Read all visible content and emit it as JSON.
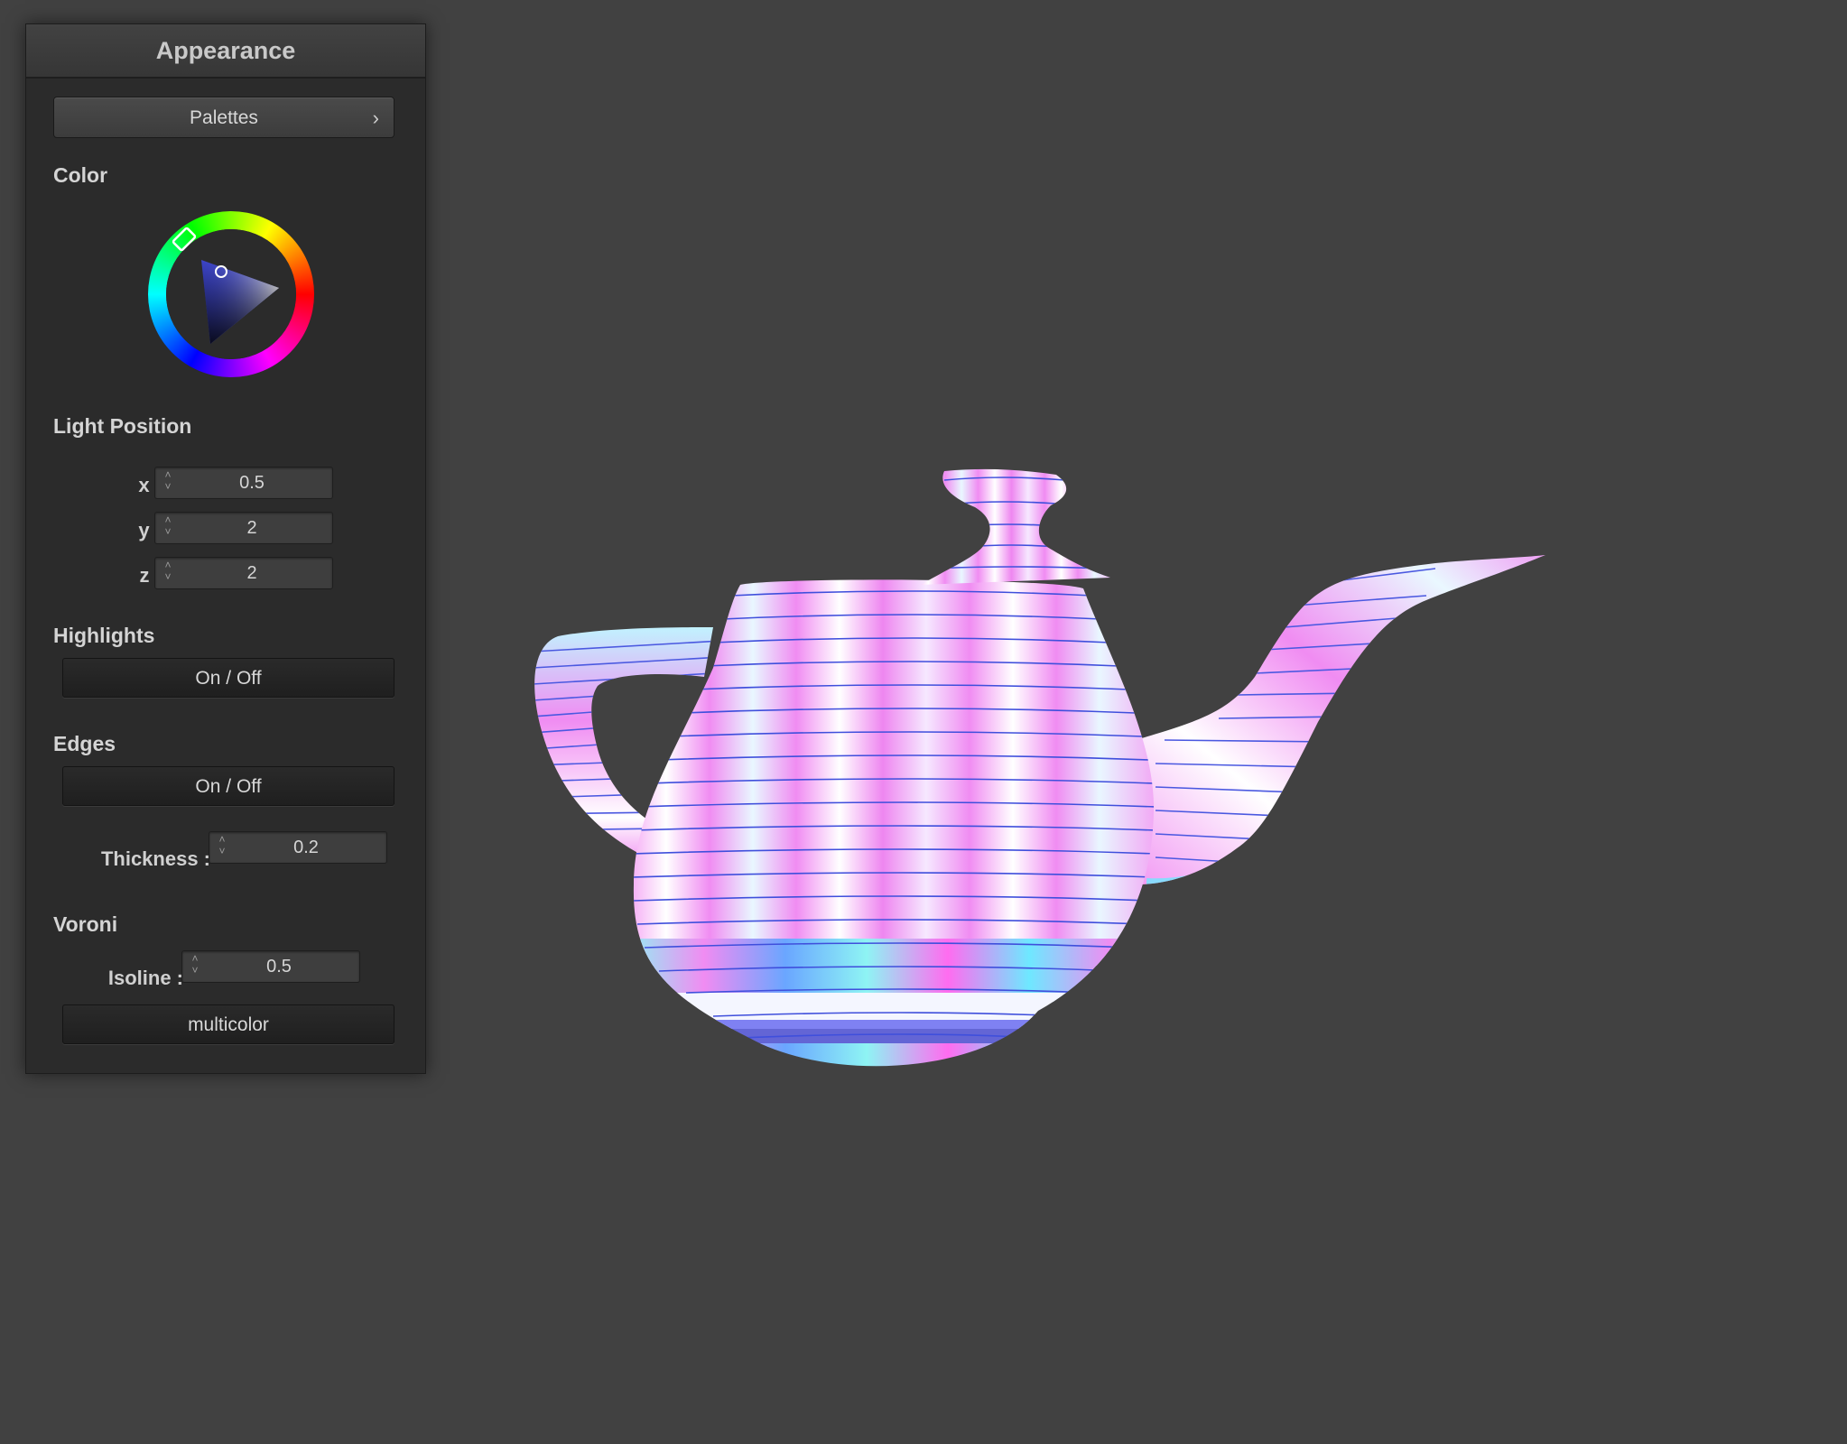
{
  "panel": {
    "title": "Appearance",
    "palettes_label": "Palettes",
    "palettes_chevron": "›",
    "color_label": "Color",
    "light_label": "Light Position",
    "light": [
      {
        "axis": "x :",
        "value": "0.5"
      },
      {
        "axis": "y :",
        "value": "2"
      },
      {
        "axis": "z :",
        "value": "2"
      }
    ],
    "highlights_label": "Highlights",
    "highlights_toggle": "On / Off",
    "edges_label": "Edges",
    "edges_toggle": "On / Off",
    "thickness_label": "Thickness :",
    "thickness_value": "0.2",
    "voronoi_label": "Voroni",
    "isoline_label": "Isoline :",
    "isoline_value": "0.5",
    "multicolor_label": "multicolor"
  },
  "icons": {
    "spinner": "spinner-arrows-icon",
    "chevron": "chevron-right-icon"
  },
  "colors": {
    "background": "#414141",
    "panel": "#2b2b2b",
    "teapot_pink": "#f08cf2",
    "teapot_cyan": "#8ef4f4",
    "teapot_blue": "#5a6cf0",
    "hue_selected": "#3c44c8"
  }
}
